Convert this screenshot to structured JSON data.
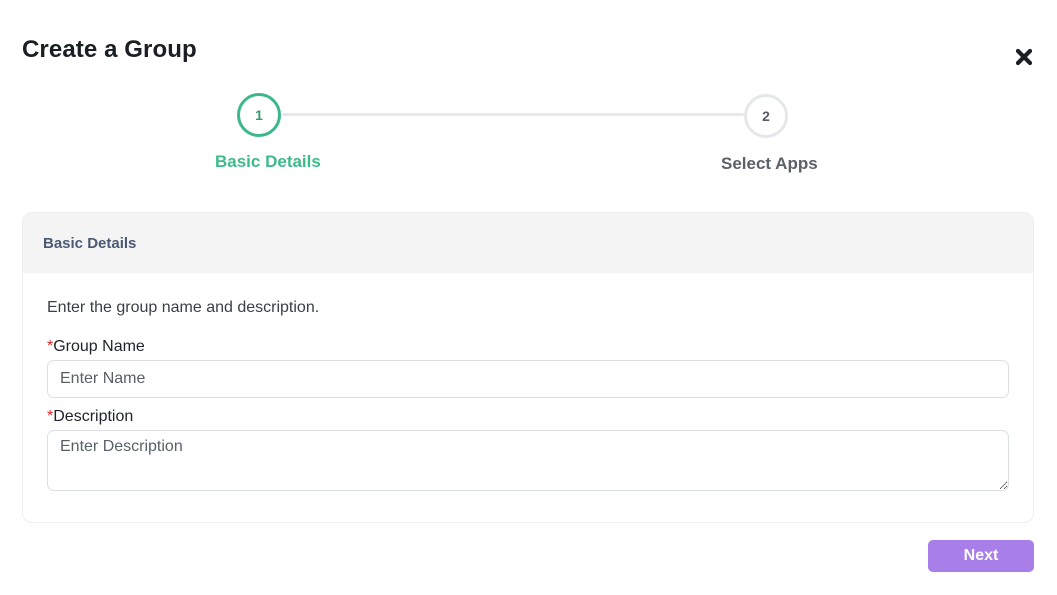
{
  "dialog": {
    "title": "Create a Group",
    "close_icon": "close-icon"
  },
  "stepper": {
    "steps": [
      {
        "number": "1",
        "label": "Basic Details",
        "state": "active"
      },
      {
        "number": "2",
        "label": "Select Apps",
        "state": "inactive"
      }
    ],
    "active_color": "#3dbb8a",
    "inactive_color": "#5c6168"
  },
  "card": {
    "header": "Basic Details",
    "description": "Enter the group name and description.",
    "fields": {
      "group_name": {
        "required_mark": "*",
        "label": "Group Name",
        "placeholder": "Enter Name",
        "value": ""
      },
      "description": {
        "required_mark": "*",
        "label": "Description",
        "placeholder": "Enter Description",
        "value": ""
      }
    }
  },
  "footer": {
    "next_label": "Next",
    "next_color": "#a87ee8"
  }
}
